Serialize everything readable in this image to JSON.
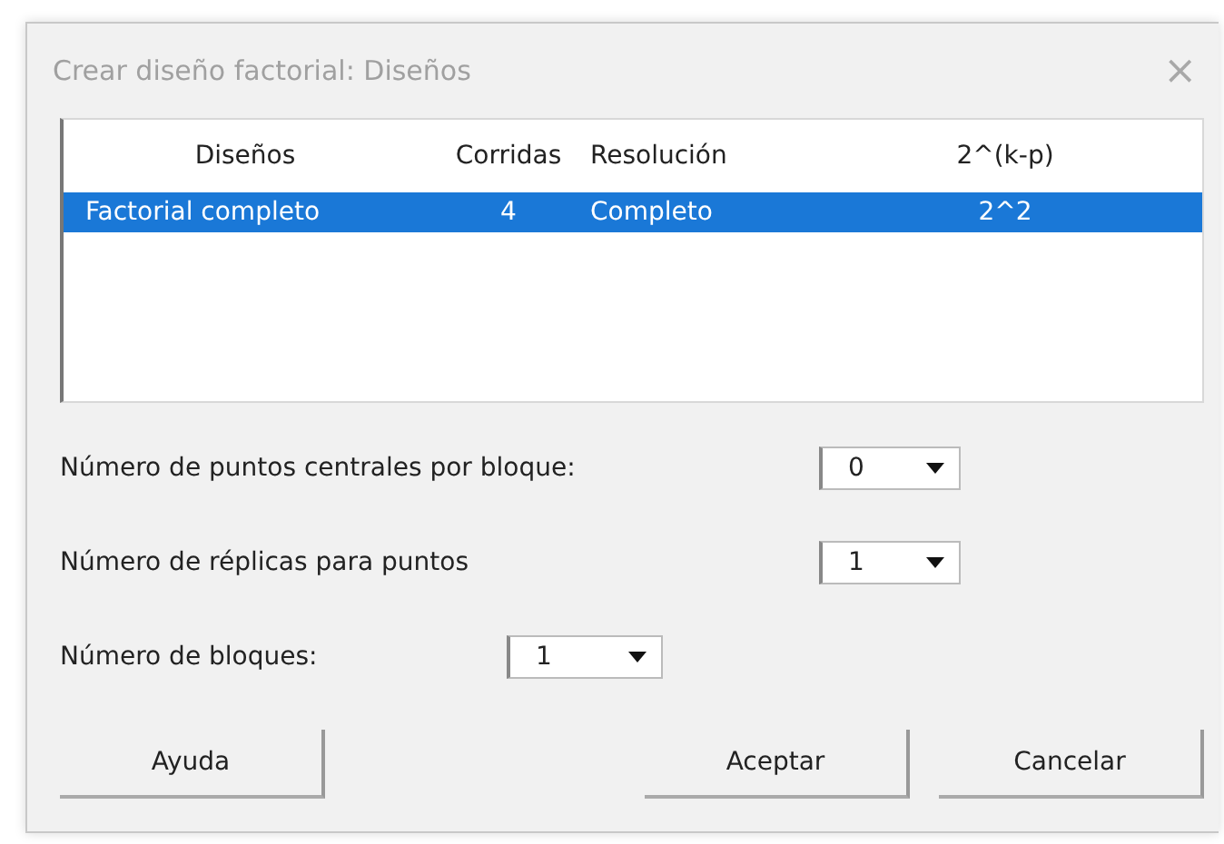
{
  "window": {
    "title": "Crear diseño factorial: Diseños",
    "close": "×"
  },
  "table": {
    "columns": [
      "Diseños",
      "Corridas",
      "Resolución",
      "2^(k-p)"
    ],
    "rows": [
      {
        "cells": [
          "Factorial completo",
          "4",
          "Completo",
          "2^2"
        ],
        "selected": true
      }
    ]
  },
  "fields": [
    {
      "label": "Número de puntos centrales por bloque:",
      "value": "0"
    },
    {
      "label": "Número de réplicas para puntos",
      "value": "1"
    },
    {
      "label": "Número de bloques:",
      "value": "1"
    }
  ],
  "buttons": [
    "Ayuda",
    "Aceptar",
    "Cancelar"
  ]
}
